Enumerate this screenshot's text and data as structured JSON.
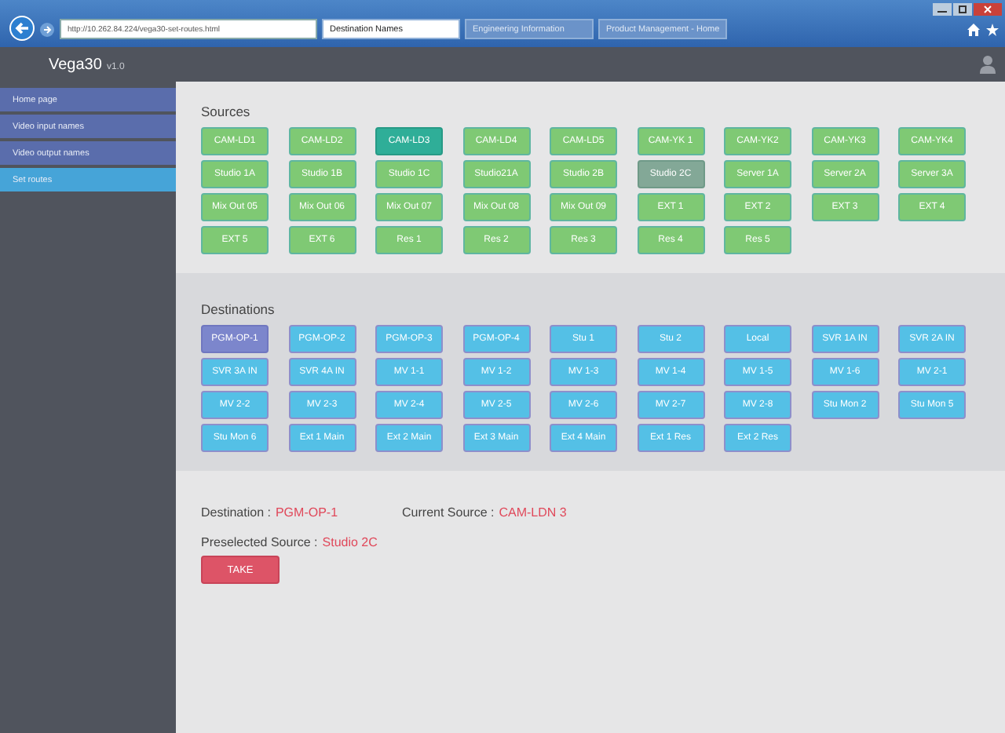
{
  "browser": {
    "address": "http://10.262.84.224/vega30-set-routes.html",
    "tabs": [
      {
        "label": "Destination Names",
        "selected": true
      },
      {
        "label": "Engineering Information",
        "selected": false
      },
      {
        "label": "Product Management - Home",
        "selected": false
      }
    ]
  },
  "app": {
    "title": "Vega30",
    "version": "v1.0"
  },
  "sidebar": {
    "items": [
      {
        "label": "Home page",
        "selected": false
      },
      {
        "label": "Video input names",
        "selected": false
      },
      {
        "label": "Video output names",
        "selected": false
      },
      {
        "label": "Set routes",
        "selected": true
      }
    ]
  },
  "sources": {
    "title": "Sources",
    "buttons": [
      {
        "label": "CAM-LD1",
        "current": false,
        "selected": false
      },
      {
        "label": "CAM-LD2",
        "current": false,
        "selected": false
      },
      {
        "label": "CAM-LD3",
        "current": true,
        "selected": false
      },
      {
        "label": "CAM-LD4",
        "current": false,
        "selected": false
      },
      {
        "label": "CAM-LD5",
        "current": false,
        "selected": false
      },
      {
        "label": "CAM-YK 1",
        "current": false,
        "selected": false
      },
      {
        "label": "CAM-YK2",
        "current": false,
        "selected": false
      },
      {
        "label": "CAM-YK3",
        "current": false,
        "selected": false
      },
      {
        "label": "CAM-YK4",
        "current": false,
        "selected": false
      },
      {
        "label": "Studio 1A",
        "current": false,
        "selected": false
      },
      {
        "label": "Studio 1B",
        "current": false,
        "selected": false
      },
      {
        "label": "Studio 1C",
        "current": false,
        "selected": false
      },
      {
        "label": "Studio21A",
        "current": false,
        "selected": false
      },
      {
        "label": "Studio 2B",
        "current": false,
        "selected": false
      },
      {
        "label": "Studio 2C",
        "current": false,
        "selected": true
      },
      {
        "label": "Server 1A",
        "current": false,
        "selected": false
      },
      {
        "label": "Server 2A",
        "current": false,
        "selected": false
      },
      {
        "label": "Server 3A",
        "current": false,
        "selected": false
      },
      {
        "label": "Mix Out 05",
        "current": false,
        "selected": false
      },
      {
        "label": "Mix Out 06",
        "current": false,
        "selected": false
      },
      {
        "label": "Mix Out 07",
        "current": false,
        "selected": false
      },
      {
        "label": "Mix Out 08",
        "current": false,
        "selected": false
      },
      {
        "label": "Mix Out 09",
        "current": false,
        "selected": false
      },
      {
        "label": "EXT 1",
        "current": false,
        "selected": false
      },
      {
        "label": "EXT 2",
        "current": false,
        "selected": false
      },
      {
        "label": "EXT 3",
        "current": false,
        "selected": false
      },
      {
        "label": "EXT 4",
        "current": false,
        "selected": false
      },
      {
        "label": "EXT 5",
        "current": false,
        "selected": false
      },
      {
        "label": "EXT 6",
        "current": false,
        "selected": false
      },
      {
        "label": "Res 1",
        "current": false,
        "selected": false
      },
      {
        "label": "Res 2",
        "current": false,
        "selected": false
      },
      {
        "label": "Res 3",
        "current": false,
        "selected": false
      },
      {
        "label": "Res 4",
        "current": false,
        "selected": false
      },
      {
        "label": "Res 5",
        "current": false,
        "selected": false
      }
    ]
  },
  "destinations": {
    "title": "Destinations",
    "buttons": [
      {
        "label": "PGM-OP-1",
        "selected": true
      },
      {
        "label": "PGM-OP-2",
        "selected": false
      },
      {
        "label": "PGM-OP-3",
        "selected": false
      },
      {
        "label": "PGM-OP-4",
        "selected": false
      },
      {
        "label": "Stu 1",
        "selected": false
      },
      {
        "label": "Stu 2",
        "selected": false
      },
      {
        "label": "Local",
        "selected": false
      },
      {
        "label": "SVR 1A IN",
        "selected": false
      },
      {
        "label": "SVR 2A IN",
        "selected": false
      },
      {
        "label": "SVR 3A IN",
        "selected": false
      },
      {
        "label": "SVR 4A IN",
        "selected": false
      },
      {
        "label": "MV 1-1",
        "selected": false
      },
      {
        "label": "MV 1-2",
        "selected": false
      },
      {
        "label": "MV 1-3",
        "selected": false
      },
      {
        "label": "MV 1-4",
        "selected": false
      },
      {
        "label": "MV 1-5",
        "selected": false
      },
      {
        "label": "MV 1-6",
        "selected": false
      },
      {
        "label": "MV 2-1",
        "selected": false
      },
      {
        "label": "MV 2-2",
        "selected": false
      },
      {
        "label": "MV 2-3",
        "selected": false
      },
      {
        "label": "MV 2-4",
        "selected": false
      },
      {
        "label": "MV 2-5",
        "selected": false
      },
      {
        "label": "MV 2-6",
        "selected": false
      },
      {
        "label": "MV 2-7",
        "selected": false
      },
      {
        "label": "MV 2-8",
        "selected": false
      },
      {
        "label": "Stu Mon 2",
        "selected": false
      },
      {
        "label": "Stu Mon 5",
        "selected": false
      },
      {
        "label": "Stu Mon 6",
        "selected": false
      },
      {
        "label": "Ext 1 Main",
        "selected": false
      },
      {
        "label": "Ext 2 Main",
        "selected": false
      },
      {
        "label": "Ext 3 Main",
        "selected": false
      },
      {
        "label": "Ext 4 Main",
        "selected": false
      },
      {
        "label": "Ext 1 Res",
        "selected": false
      },
      {
        "label": "Ext 2 Res",
        "selected": false
      }
    ]
  },
  "info": [
    {
      "label": "Destination :",
      "value": "PGM-OP-1"
    },
    {
      "label": "Current Source :",
      "value": "CAM-LDN 3"
    },
    {
      "label": "Preselected Source :",
      "value": "Studio 2C"
    }
  ],
  "take_button": "TAKE"
}
